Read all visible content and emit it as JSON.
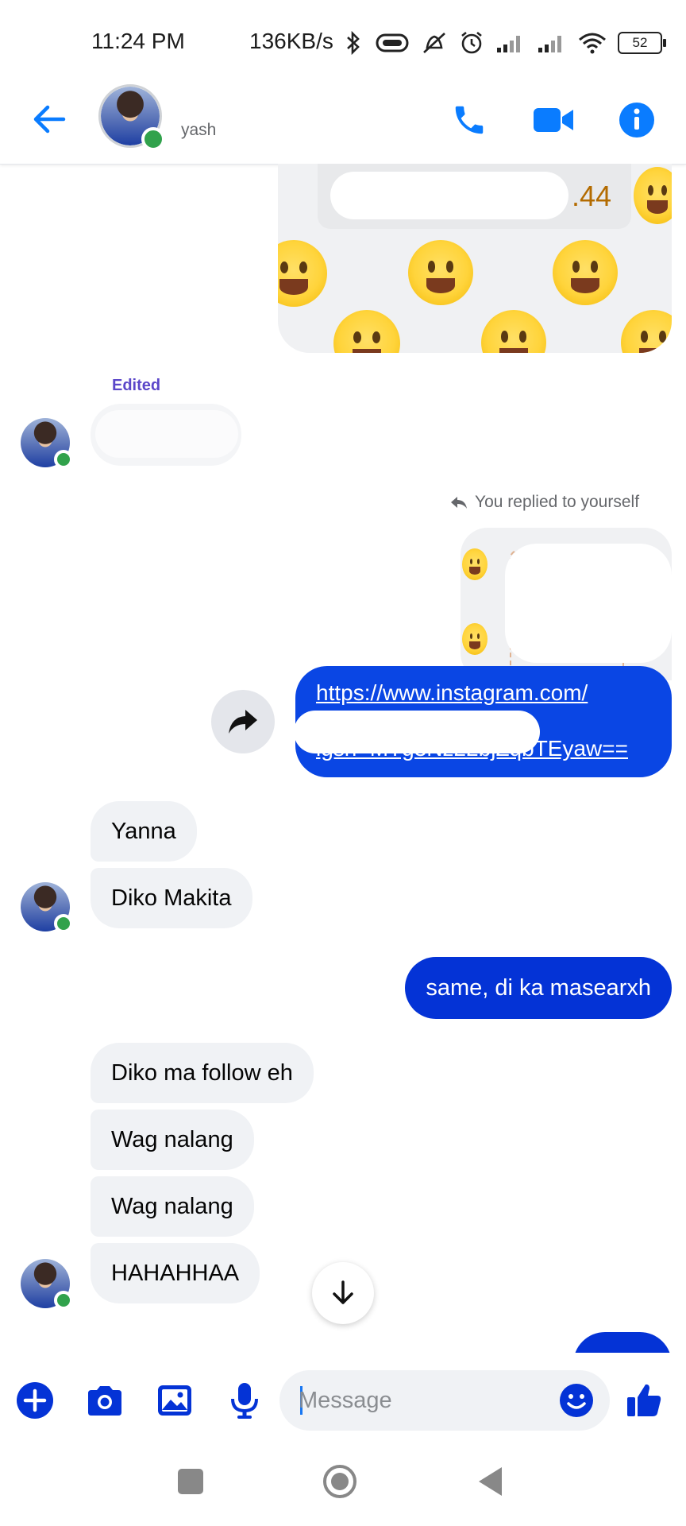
{
  "status_bar": {
    "time": "11:24 PM",
    "net_speed": "136KB/s",
    "battery": "52",
    "icons": [
      "bluetooth-icon",
      "vibrate-icon",
      "mute-icon",
      "alarm-icon",
      "signal-icon",
      "signal-icon",
      "wifi-icon",
      "battery-icon"
    ]
  },
  "header": {
    "contact_name": "yash",
    "icons": [
      "back-arrow-icon",
      "phone-icon",
      "video-icon",
      "info-icon"
    ]
  },
  "conversation": {
    "partial_image_text": ".44",
    "edited_label": "Edited",
    "reply_note": "You replied to yourself",
    "link_line_1": "https://www.instagram.com/",
    "link_line_2": "igsh=MTg3Nz22bjZqbTEyaw==",
    "incoming_group_1": [
      "Yanna",
      "Diko Makita"
    ],
    "outgoing_1": "same, di ka masearxh",
    "incoming_group_2": [
      "Diko ma follow eh",
      "Wag nalang",
      "Wag nalang",
      "HAHAHHAA"
    ]
  },
  "composer": {
    "placeholder": "Message",
    "icons": [
      "add-icon",
      "camera-icon",
      "gallery-icon",
      "mic-icon",
      "emoji-icon",
      "thumbs-up-icon"
    ]
  },
  "colors": {
    "accent": "#0a46e4",
    "outgoing_bubble": "#0433d6",
    "incoming_bubble": "#f0f2f5",
    "online": "#31a24c"
  }
}
